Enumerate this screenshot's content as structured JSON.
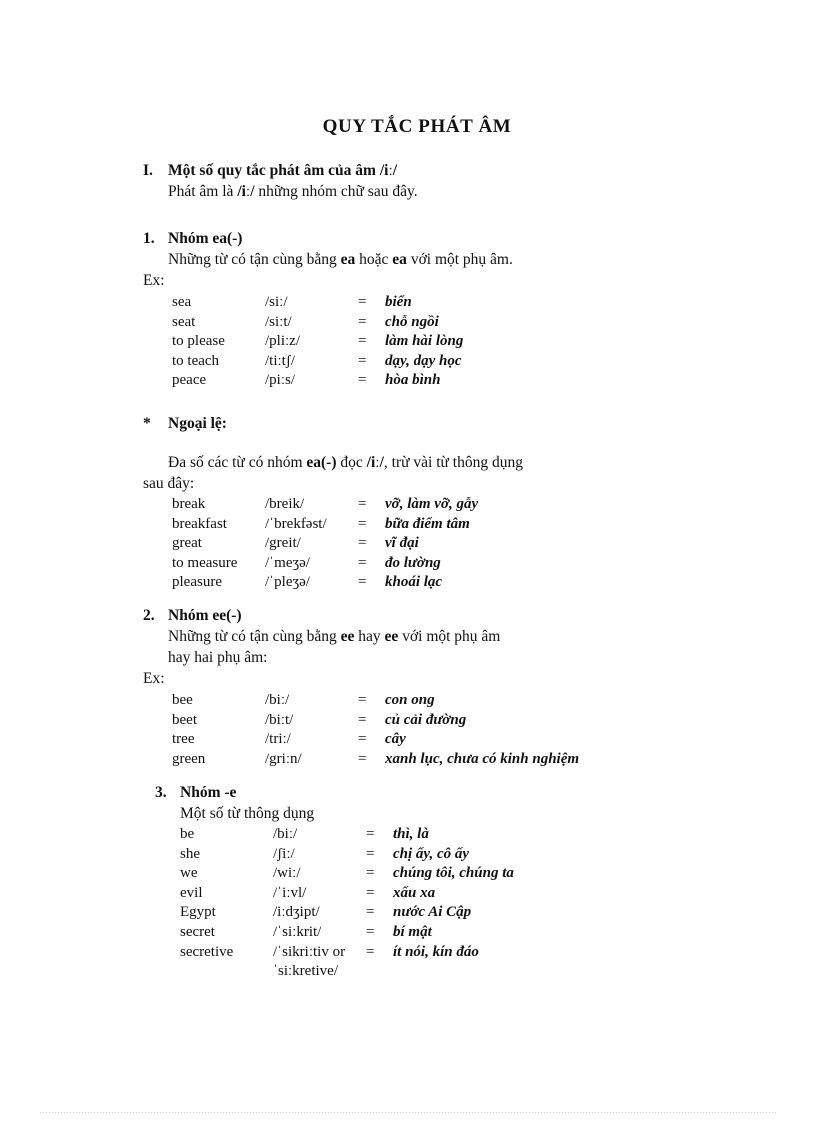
{
  "document": {
    "title": "QUY TẮC PHÁT ÂM",
    "language": "vi"
  },
  "section_I": {
    "marker": "I.",
    "heading_pre": "Một số quy tắc phát âm của âm ",
    "heading_ipa": "/iː/",
    "subtitle_pre": "Phát âm là ",
    "subtitle_ipa": "/iː/",
    "subtitle_post": " những nhóm chữ sau đây."
  },
  "group_1": {
    "marker": "1.",
    "heading": "Nhóm ea(-)",
    "rule_pre": "Những từ có tận cùng bằng ",
    "rule_b1": "ea",
    "rule_mid": " hoặc ",
    "rule_b2": "ea",
    "rule_post": " với một phụ âm.",
    "ex_label": "Ex:",
    "entries": [
      {
        "word": "sea",
        "ipa": "/siː/",
        "eq": "=",
        "meaning": "biển"
      },
      {
        "word": "seat",
        "ipa": "/siːt/",
        "eq": "=",
        "meaning": "chỗ ngồi"
      },
      {
        "word": "to please",
        "ipa": "/pliːz/",
        "eq": "=",
        "meaning": "làm hài lòng"
      },
      {
        "word": "to teach",
        "ipa": "/tiːtʃ/",
        "eq": "=",
        "meaning": "dạy, dạy học"
      },
      {
        "word": "peace",
        "ipa": "/piːs/",
        "eq": "=",
        "meaning": "hòa bình"
      }
    ]
  },
  "exception": {
    "marker": "*",
    "heading": "Ngoại lệ:",
    "rule_pre": "Đa số các từ có nhóm ",
    "rule_b1": "ea(-)",
    "rule_mid": " đọc ",
    "rule_ipa": "/iː/",
    "rule_post": ", trừ vài từ thông dụng",
    "rule_line2": "sau đây:",
    "entries": [
      {
        "word": "break",
        "ipa": "/breik/",
        "eq": "=",
        "meaning": "vỡ, làm vỡ, gẫy"
      },
      {
        "word": "breakfast",
        "ipa": "/ˈbrekfəst/",
        "eq": "=",
        "meaning": "bữa điểm tâm"
      },
      {
        "word": "great",
        "ipa": "/greit/",
        "eq": "=",
        "meaning": "vĩ đại"
      },
      {
        "word": "to measure",
        "ipa": "/ˈmeʒə/",
        "eq": "=",
        "meaning": "đo lường"
      },
      {
        "word": "pleasure",
        "ipa": "/ˈpleʒə/",
        "eq": "=",
        "meaning": "khoái lạc"
      }
    ]
  },
  "group_2": {
    "marker": "2.",
    "heading": "Nhóm ee(-)",
    "rule_pre": "Những từ có tận cùng bằng ",
    "rule_b1": "ee",
    "rule_mid": " hay ",
    "rule_b2": "ee",
    "rule_post": " với một phụ âm",
    "rule_line2": "hay hai phụ âm:",
    "ex_label": "Ex:",
    "entries": [
      {
        "word": "bee",
        "ipa": "/biː/",
        "eq": "=",
        "meaning": "con ong"
      },
      {
        "word": "beet",
        "ipa": "/biːt/",
        "eq": "=",
        "meaning": "củ cải đường"
      },
      {
        "word": "tree",
        "ipa": "/triː/",
        "eq": "=",
        "meaning": "cây"
      },
      {
        "word": "green",
        "ipa": "/griːn/",
        "eq": "=",
        "meaning": "xanh lục, chưa có kinh nghiệm"
      }
    ]
  },
  "group_3": {
    "marker": "3.",
    "heading": "Nhóm -e",
    "rule_line": "Một số từ thông dụng",
    "entries": [
      {
        "word": "be",
        "ipa": "/biː/",
        "ipa2": "",
        "eq": "=",
        "meaning": "thì, là"
      },
      {
        "word": "she",
        "ipa": "/ʃiː/",
        "ipa2": "",
        "eq": "=",
        "meaning": "chị ấy, cô ấy"
      },
      {
        "word": "we",
        "ipa": "/wiː/",
        "ipa2": "",
        "eq": "=",
        "meaning": "chúng tôi, chúng ta"
      },
      {
        "word": "evil",
        "ipa": "/ˈiːvl/",
        "ipa2": "",
        "eq": "=",
        "meaning": "xấu xa"
      },
      {
        "word": "Egypt",
        "ipa": "/iːdʒipt/",
        "ipa2": "",
        "eq": "=",
        "meaning": "nước Ai Cập"
      },
      {
        "word": "secret",
        "ipa": "/ˈsiːkrit/",
        "ipa2": "",
        "eq": "=",
        "meaning": "bí mật"
      },
      {
        "word": "secretive",
        "ipa": "/ˈsikriːtiv or",
        "ipa2": "ˈsiːkretive/",
        "eq": "=",
        "meaning": "ít nói, kín đáo"
      }
    ]
  }
}
